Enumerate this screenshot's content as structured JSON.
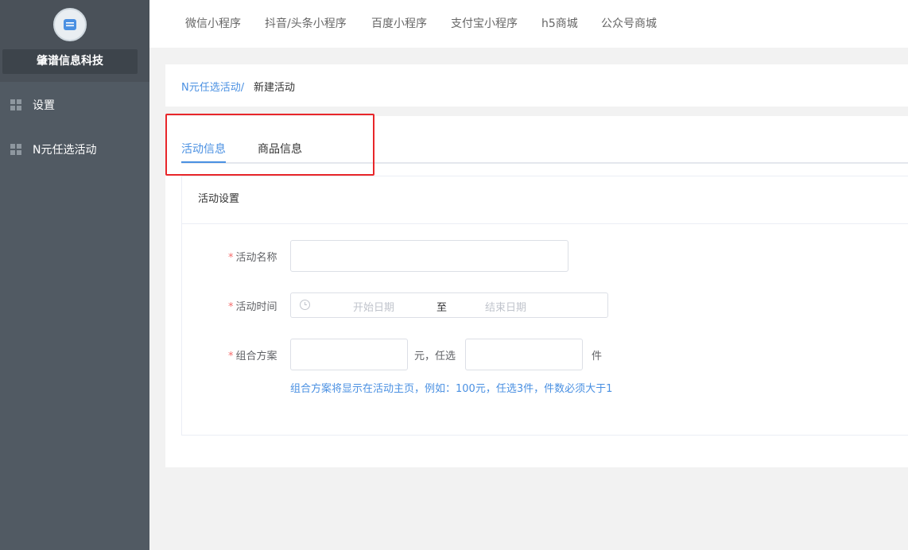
{
  "sidebar": {
    "brand": "肇谱信息科技",
    "items": [
      {
        "label": "设置"
      },
      {
        "label": "N元任选活动"
      }
    ]
  },
  "topnav": {
    "tabs": [
      "微信小程序",
      "抖音/头条小程序",
      "百度小程序",
      "支付宝小程序",
      "h5商城",
      "公众号商城"
    ]
  },
  "breadcrumb": {
    "parent": "N元任选活动/",
    "current": "新建活动"
  },
  "tabs": {
    "active": "活动信息",
    "inactive": "商品信息"
  },
  "card": {
    "title": "活动设置"
  },
  "form": {
    "name_label": "活动名称",
    "name_value": "",
    "time_label": "活动时间",
    "start_placeholder": "开始日期",
    "separator": "至",
    "end_placeholder": "结束日期",
    "combo_label": "组合方案",
    "amount_value": "",
    "amount_unit": "元，任选",
    "count_value": "",
    "count_unit": "件",
    "hint": "组合方案将显示在活动主页，例如：100元，任选3件，件数必须大于1",
    "required_mark": "*"
  },
  "colors": {
    "sidebar_bg": "#515a63",
    "accent": "#4a90e2",
    "highlight": "#e8262a",
    "required": "#f56c6c"
  }
}
